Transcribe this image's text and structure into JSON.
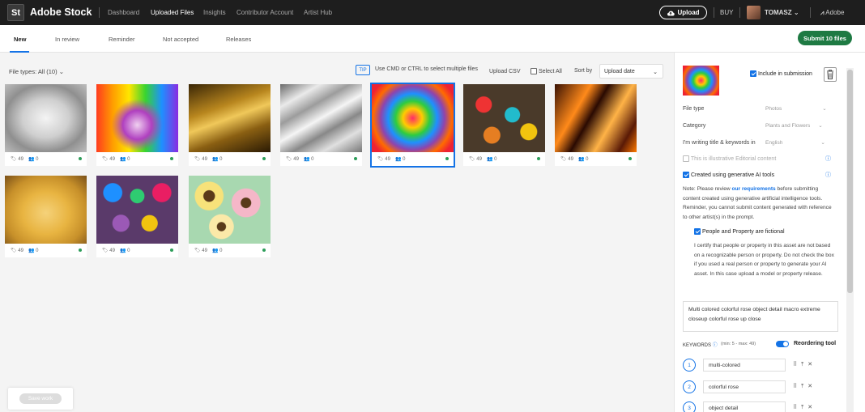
{
  "topbar": {
    "logo": "St",
    "brand": "Adobe Stock",
    "nav": [
      "Dashboard",
      "Uploaded Files",
      "Insights",
      "Contributor Account",
      "Artist Hub"
    ],
    "upload": "Upload",
    "buy": "BUY",
    "user": "TOMASZ",
    "adobe": "Adobe"
  },
  "tabs": [
    "New",
    "In review",
    "Reminder",
    "Not accepted",
    "Releases"
  ],
  "submit_label": "Submit 10 files",
  "toolbar": {
    "file_types": "File types: All (10)",
    "tip": "TIP",
    "tip_text": "Use CMD or CTRL to select multiple files",
    "upload_csv": "Upload CSV",
    "select_all": "Select All",
    "sort_by": "Sort by",
    "sort_value": "Upload date"
  },
  "files": [
    {
      "kw": "49",
      "people": "0",
      "name": "foil"
    },
    {
      "kw": "49",
      "people": "0",
      "name": "skull"
    },
    {
      "kw": "49",
      "people": "0",
      "name": "gold"
    },
    {
      "kw": "49",
      "people": "0",
      "name": "silver"
    },
    {
      "kw": "49",
      "people": "0",
      "name": "rose"
    },
    {
      "kw": "49",
      "people": "0",
      "name": "gems"
    },
    {
      "kw": "49",
      "people": "0",
      "name": "flames"
    },
    {
      "kw": "49",
      "people": "0",
      "name": "chips"
    },
    {
      "kw": "49",
      "people": "0",
      "name": "jewels"
    },
    {
      "kw": "49",
      "people": "0",
      "name": "flowers"
    }
  ],
  "save_work": "Save work",
  "panel": {
    "include": "Include in submission",
    "file_type_label": "File type",
    "file_type_value": "Photos",
    "category_label": "Category",
    "category_value": "Plants and Flowers",
    "language_label": "I'm writing title & keywords in",
    "language_value": "English",
    "editorial": "This is illustrative Editorial content",
    "gen_ai": "Created using generative AI tools",
    "note_1": "Note: Please review ",
    "note_link": "our requirements",
    "note_2": " before submitting content created using generative artificial intelligence tools. Reminder, you cannot submit content generated with reference to other artist(s) in the prompt.",
    "people_fictional": "People and Property are fictional",
    "certify": "I certify that people or property in this asset are not based on a recognizable person or property. Do not check the box if you used a real person or property to generate your AI asset. In this case upload a model or property release.",
    "title": "Multi colored colorful rose object detail macro extreme closeup colorful rose up close",
    "keywords_label": "KEYWORDS",
    "keywords_hint": "(min: 5 - max: 49)",
    "reorder": "Reordering tool",
    "keywords": [
      {
        "n": "1",
        "text": "multi-colored"
      },
      {
        "n": "2",
        "text": "colorful rose"
      },
      {
        "n": "3",
        "text": "object detail"
      }
    ]
  },
  "colors": {
    "accent": "#1473e6",
    "submit": "#1e7a43",
    "topbar": "#1e1e1e"
  }
}
